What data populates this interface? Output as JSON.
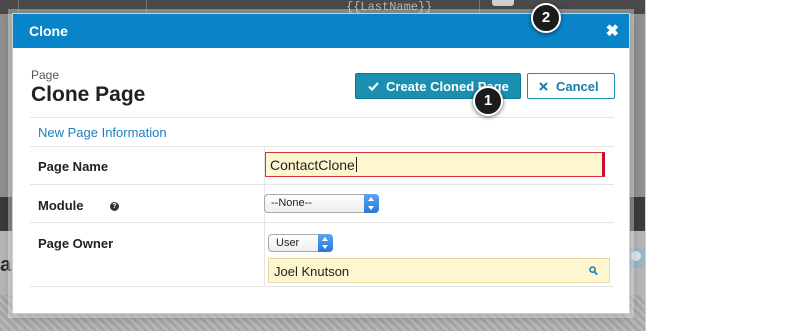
{
  "background": {
    "top_field_text": "{{LastName}}",
    "edge_heading_fragment": "ar"
  },
  "modal": {
    "title": "Clone",
    "page_kicker": "Page",
    "page_heading": "Clone Page",
    "create_button_label": "Create Cloned Page",
    "cancel_button_label": "Cancel",
    "section_title": "New Page Information",
    "fields": {
      "page_name": {
        "label": "Page Name",
        "value": "ContactClone"
      },
      "module": {
        "label": "Module",
        "value": "--None--"
      },
      "page_owner": {
        "label": "Page Owner",
        "type_value": "User",
        "lookup_value": "Joel Knutson"
      }
    }
  },
  "callouts": [
    "1",
    "2"
  ],
  "colors": {
    "header": "#0a84c8",
    "primary_button": "#1a8fb0",
    "required_border": "#c8102e",
    "input_highlight": "#fdf6cf",
    "section_link": "#1a7fbf"
  },
  "icons": [
    "close-icon",
    "check-icon",
    "x-icon",
    "help-icon",
    "search-icon",
    "map-pin-icon"
  ]
}
